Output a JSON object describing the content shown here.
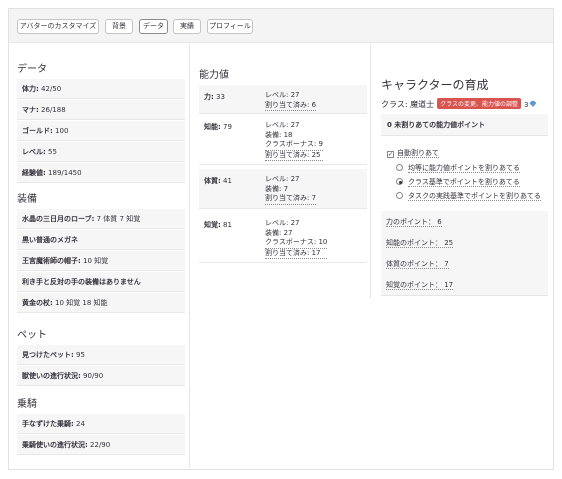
{
  "tabs": [
    {
      "label": "アバターのカスタマイズ",
      "active": false
    },
    {
      "label": "背景",
      "active": false
    },
    {
      "label": "データ",
      "active": true
    },
    {
      "label": "実績",
      "active": false
    },
    {
      "label": "プロフィール",
      "active": false
    }
  ],
  "data_section": {
    "title": "データ",
    "rows": [
      {
        "label": "体力:",
        "value": " 42/50"
      },
      {
        "label": "マナ:",
        "value": " 26/188"
      },
      {
        "label": "ゴールド:",
        "value": " 100"
      },
      {
        "label": "レベル:",
        "value": " 55"
      },
      {
        "label": "経験値:",
        "value": " 189/1450"
      }
    ]
  },
  "equipment": {
    "title": "装備",
    "rows": [
      {
        "label": "水晶の三日月のローブ:",
        "value": " 7 体質 7 知覚"
      },
      {
        "label": "黒い普通のメガネ",
        "value": ""
      },
      {
        "label": "王宮魔術師の帽子:",
        "value": " 10 知覚"
      },
      {
        "label": "利き手と反対の手の装備はありません",
        "value": ""
      },
      {
        "label": "黄金の杖:",
        "value": " 10 知覚 18 知能"
      }
    ]
  },
  "pets": {
    "title": "ペット",
    "rows": [
      {
        "label": "見つけたペット:",
        "value": " 95"
      },
      {
        "label": "獣使いの進行状況:",
        "value": " 90/90"
      }
    ]
  },
  "mounts": {
    "title": "乗騎",
    "rows": [
      {
        "label": "手なずけた乗騎:",
        "value": " 24"
      },
      {
        "label": "乗騎使いの進行状況:",
        "value": " 22/90"
      }
    ]
  },
  "stats": {
    "title": "能力値",
    "rows": [
      {
        "label": "力:",
        "value": " 33",
        "details": [
          "レベル: 27",
          "割り当て済み: 6"
        ]
      },
      {
        "label": "知能:",
        "value": " 79",
        "details": [
          "レベル: 27",
          "装備: 18",
          "クラスボーナス: 9",
          "割り当て済み: 25"
        ]
      },
      {
        "label": "体質:",
        "value": " 41",
        "details": [
          "レベル: 27",
          "装備: 7",
          "割り当て済み: 7"
        ]
      },
      {
        "label": "知覚:",
        "value": " 81",
        "details": [
          "レベル: 27",
          "装備: 27",
          "クラスボーナス: 10",
          "割り当て済み: 17"
        ]
      }
    ]
  },
  "growth": {
    "title": "キャラクターの育成",
    "class_label": "クラス: 魔道士",
    "class_badge": "クラスの変更、能力値の調整",
    "gem_count": "3",
    "unassigned": "0 未割りあての能力値ポイント",
    "auto_allocate": "自動割りあて",
    "auto_checked": "✓",
    "options": [
      {
        "label": "均等に能力値ポイントを割りあてる",
        "selected": false
      },
      {
        "label": "クラス基準でポイントを割りあてる",
        "selected": true
      },
      {
        "label": "タスクの実践基準でポイントを割りあてる",
        "selected": false
      }
    ],
    "points": [
      "力のポイント： 6",
      "知能のポイント： 25",
      "体質のポイント： 7",
      "知覚のポイント： 17"
    ]
  },
  "colors": {
    "badge": "#d9534f",
    "gem": "#5b9bd5"
  },
  "icons": {
    "gem": "gem-icon",
    "checkbox": "checkbox-icon",
    "radio": "radio-icon"
  }
}
